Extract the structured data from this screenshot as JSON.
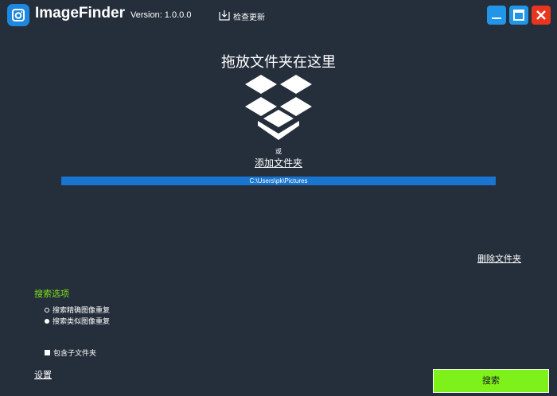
{
  "titlebar": {
    "app_name": "ImageFinder",
    "version": "Version: 1.0.0.0",
    "check_update_label": "检查更新",
    "icons": {
      "app": "camera-icon",
      "update": "download-icon",
      "minimize": "minimize-icon",
      "maximize": "maximize-icon",
      "close": "close-icon"
    }
  },
  "drop_zone": {
    "title": "拖放文件夹在这里",
    "icon": "dropbox-icon",
    "or_text": "或",
    "add_folder_label": "添加文件夹"
  },
  "folders": [
    "C:\\Users\\pk\\Pictures"
  ],
  "delete_folder_label": "删除文件夹",
  "search_options": {
    "title": "搜索选项",
    "mode_options": [
      {
        "label": "搜索精确图像重复",
        "selected": false
      },
      {
        "label": "搜索类似图像重复",
        "selected": true
      }
    ],
    "include_subfolders_label": "包含子文件夹",
    "include_subfolders": true
  },
  "settings_label": "设置",
  "search_button_label": "搜索",
  "colors": {
    "background": "#252f3b",
    "accent_blue": "#1975cf",
    "options_title": "#7fdc1c",
    "search_button": "#7ef01a",
    "close_button": "#e8361e",
    "window_button": "#2196e8"
  }
}
